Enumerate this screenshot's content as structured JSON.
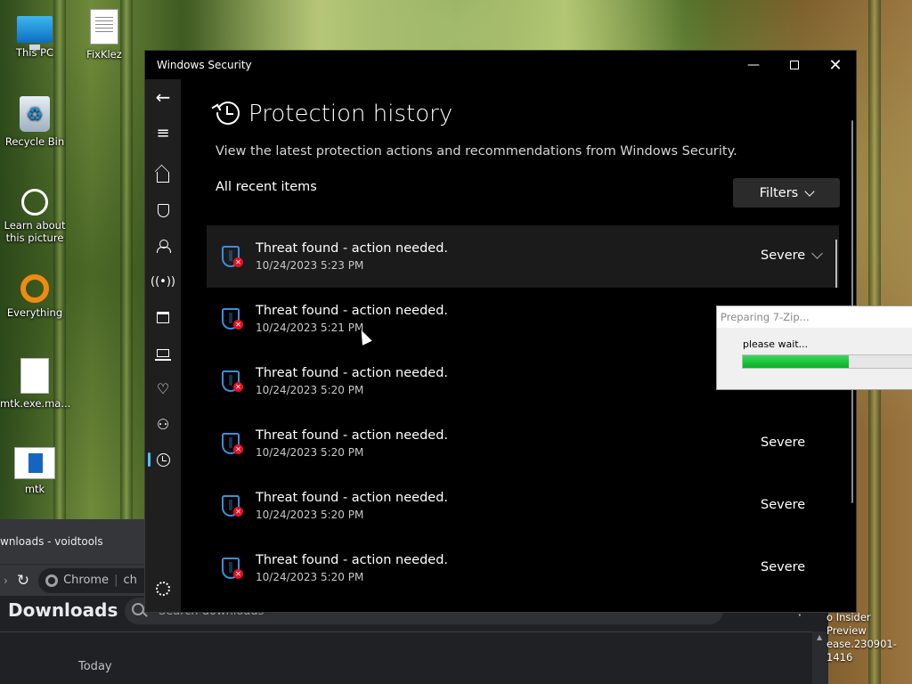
{
  "desktop": {
    "icons": [
      {
        "label": "This PC",
        "icon": "this-pc-icon"
      },
      {
        "label": "FixKlez",
        "icon": "document-icon"
      },
      {
        "label": "Recycle Bin",
        "icon": "recycle-bin-icon"
      },
      {
        "label": "Learn about this picture",
        "icon": "learn-icon"
      },
      {
        "label": "Everything",
        "icon": "everything-icon"
      },
      {
        "label": "mtk.exe.ma...",
        "icon": "file-icon"
      },
      {
        "label": "mtk",
        "icon": "mtk-icon"
      }
    ],
    "insider_text_1": "o Insider Preview",
    "insider_text_2": "ease.230901-1416"
  },
  "chrome": {
    "tab_title": "wnloads - voidtools",
    "omnibox_label": "Chrome",
    "omnibox_text": "ch",
    "page_title": "Downloads",
    "search_placeholder": "Search downloads",
    "section_today": "Today"
  },
  "security": {
    "window_title": "Windows Security",
    "page_title": "Protection history",
    "description": "View the latest protection actions and recommendations from Windows Security.",
    "section_label": "All recent items",
    "filters_label": "Filters",
    "items": [
      {
        "title": "Threat found - action needed.",
        "date": "10/24/2023 5:23 PM",
        "severity": "Severe"
      },
      {
        "title": "Threat found - action needed.",
        "date": "10/24/2023 5:21 PM",
        "severity": ""
      },
      {
        "title": "Threat found - action needed.",
        "date": "10/24/2023 5:20 PM",
        "severity": ""
      },
      {
        "title": "Threat found - action needed.",
        "date": "10/24/2023 5:20 PM",
        "severity": "Severe"
      },
      {
        "title": "Threat found - action needed.",
        "date": "10/24/2023 5:20 PM",
        "severity": "Severe"
      },
      {
        "title": "Threat found - action needed.",
        "date": "10/24/2023 5:20 PM",
        "severity": "Severe"
      }
    ]
  },
  "zip_dialog": {
    "title": "Preparing 7-Zip...",
    "message": "please wait...",
    "progress": 0.6
  },
  "colors": {
    "accent": "#4cc2ff",
    "threat_red": "#e81123",
    "shield_blue": "#3b8fd9",
    "progress_green": "#06b025"
  }
}
